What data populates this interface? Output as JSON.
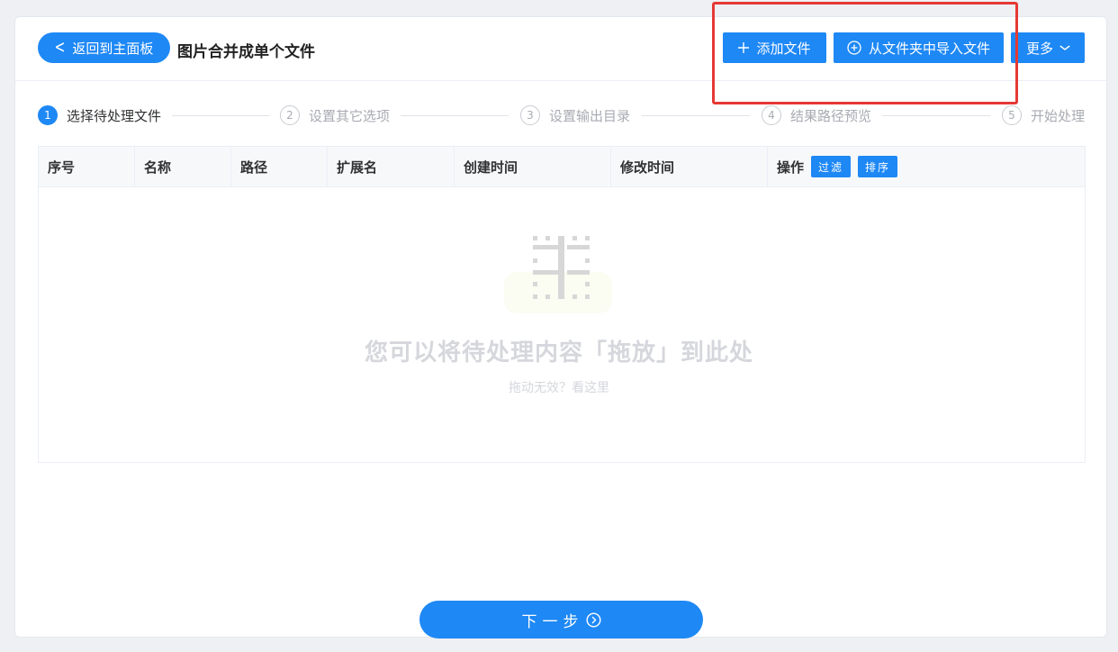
{
  "header": {
    "back_label": "返回到主面板",
    "back_icon": "chevron-left-icon",
    "title": "图片合并成单个文件",
    "add_file_label": "添加文件",
    "add_icon": "plus-icon",
    "import_folder_label": "从文件夹中导入文件",
    "import_icon": "plus-circle-icon",
    "more_label": "更多",
    "more_icon": "chevron-down-icon"
  },
  "steps": [
    {
      "num": "1",
      "label": "选择待处理文件",
      "active": true
    },
    {
      "num": "2",
      "label": "设置其它选项",
      "active": false
    },
    {
      "num": "3",
      "label": "设置输出目录",
      "active": false
    },
    {
      "num": "4",
      "label": "结果路径预览",
      "active": false
    },
    {
      "num": "5",
      "label": "开始处理",
      "active": false
    }
  ],
  "table": {
    "columns": [
      "序号",
      "名称",
      "路径",
      "扩展名",
      "创建时间",
      "修改时间",
      "操作"
    ],
    "filter_label": "过滤",
    "sort_label": "排序"
  },
  "empty": {
    "title": "您可以将待处理内容「拖放」到此处",
    "help_link": "拖动无效？看这里"
  },
  "footer": {
    "next_label": "下一步",
    "next_icon": "arrow-circle-right-icon"
  },
  "colors": {
    "accent": "#1e88f5",
    "highlight": "#e53935"
  }
}
